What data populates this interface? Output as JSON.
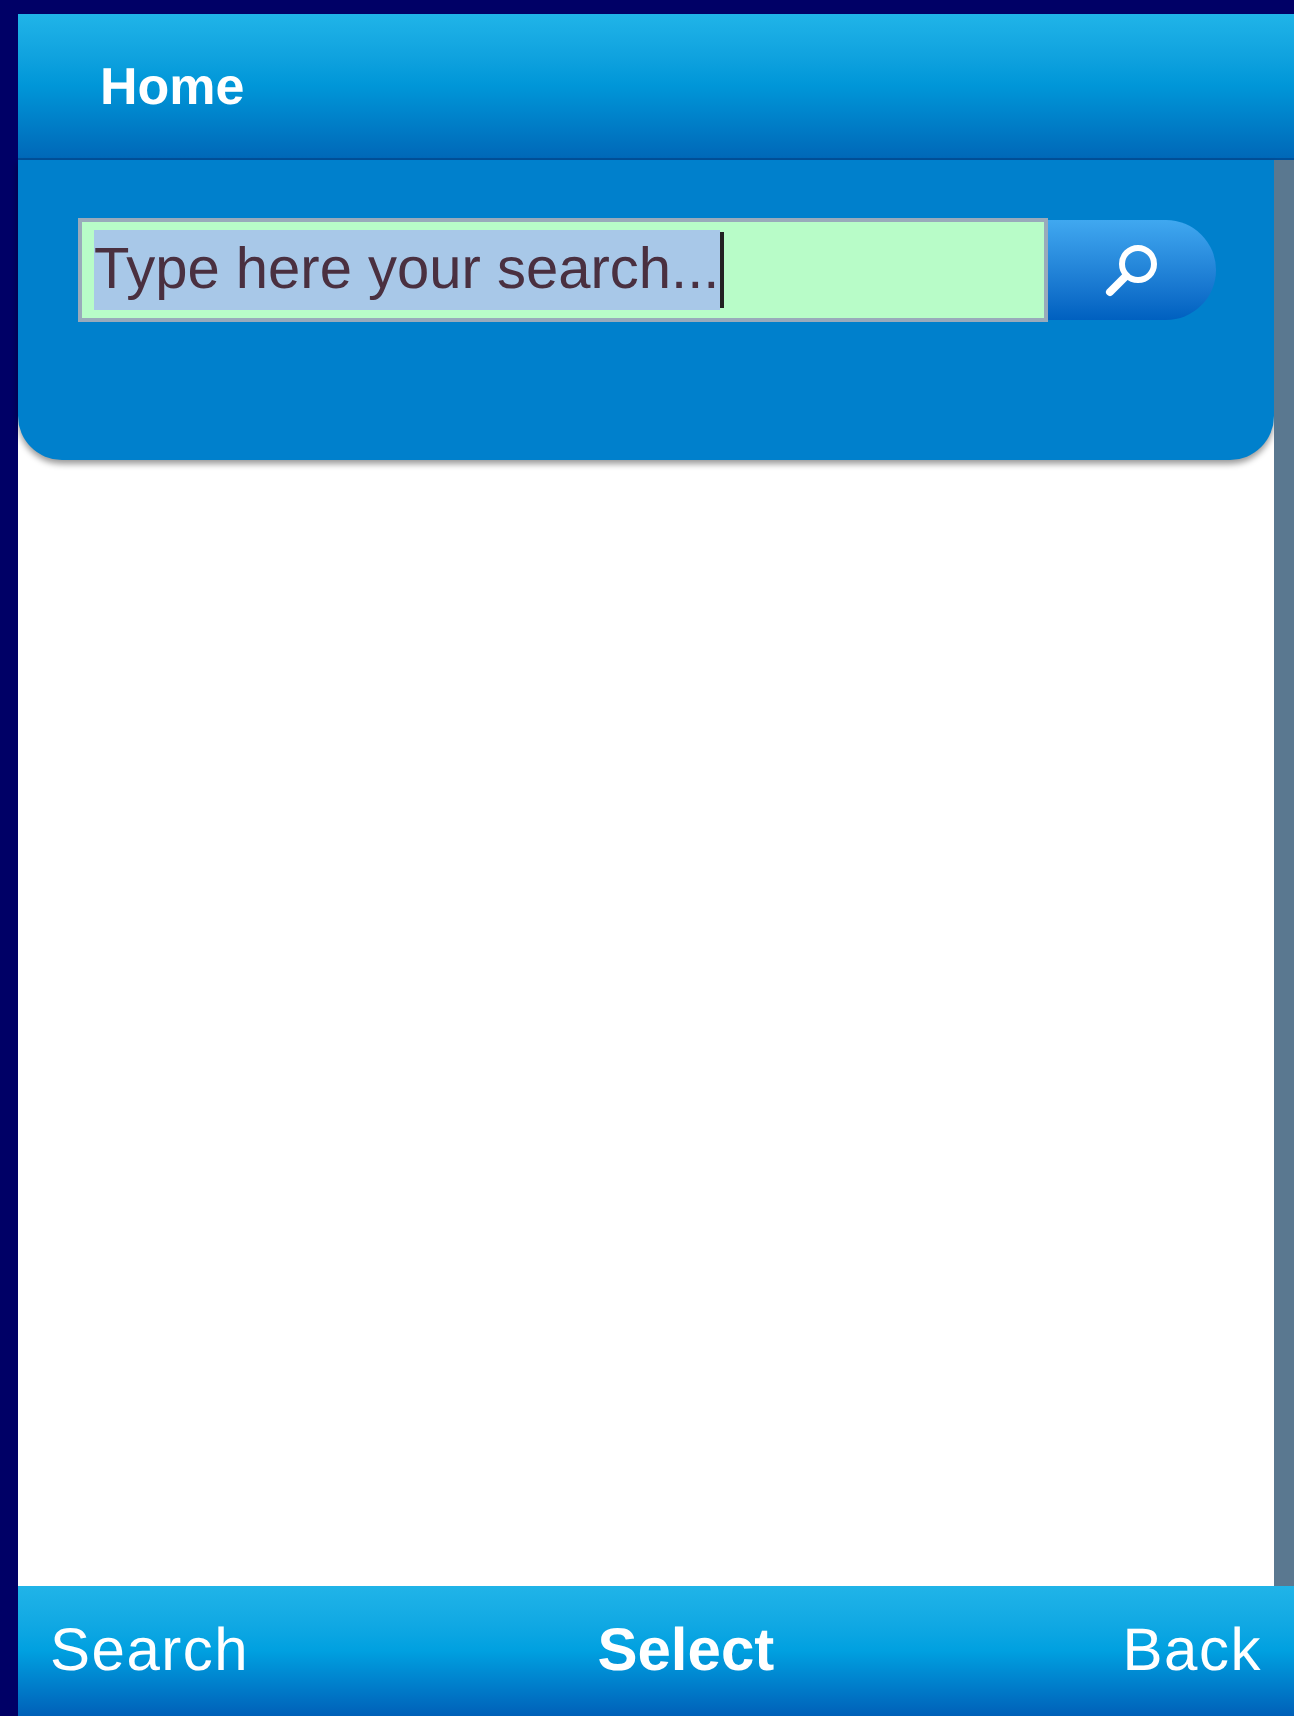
{
  "title_bar": {
    "title": "Home"
  },
  "search": {
    "value": "Type here your search...",
    "text_selected": true
  },
  "softkeys": [
    {
      "label": "Search",
      "kind": "left"
    },
    {
      "label": "Select",
      "kind": "center"
    },
    {
      "label": "Back",
      "kind": "right"
    }
  ]
}
